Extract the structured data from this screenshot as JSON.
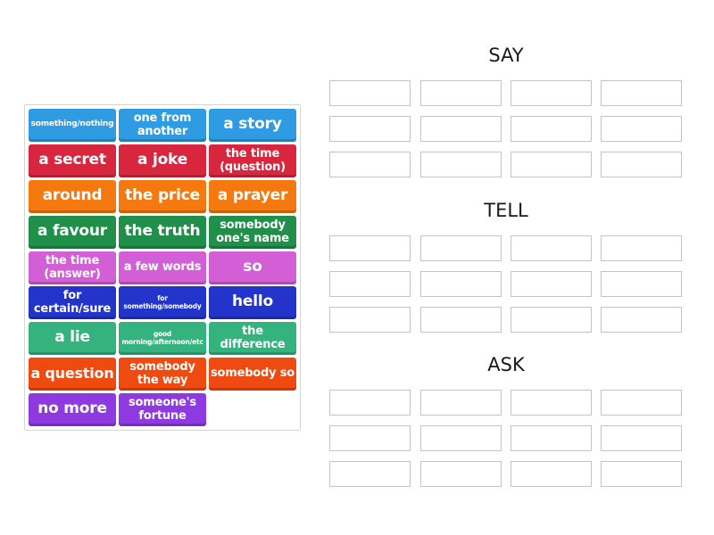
{
  "word_bank": {
    "tiles": [
      {
        "label": "something/nothing",
        "color": "#2e9be3"
      },
      {
        "label": "one from another",
        "color": "#2e9be3"
      },
      {
        "label": "a story",
        "color": "#2e9be3"
      },
      {
        "label": "a secret",
        "color": "#d7263d"
      },
      {
        "label": "a joke",
        "color": "#d7263d"
      },
      {
        "label": "the time (question)",
        "color": "#d7263d"
      },
      {
        "label": "around",
        "color": "#f5790f"
      },
      {
        "label": "the price",
        "color": "#f5790f"
      },
      {
        "label": "a prayer",
        "color": "#f5790f"
      },
      {
        "label": "a favour",
        "color": "#1f8f4a"
      },
      {
        "label": "the truth",
        "color": "#1f8f4a"
      },
      {
        "label": "somebody one's name",
        "color": "#1f8f4a"
      },
      {
        "label": "the time (answer)",
        "color": "#d35fd6"
      },
      {
        "label": "a few words",
        "color": "#d35fd6"
      },
      {
        "label": "so",
        "color": "#d35fd6"
      },
      {
        "label": "for certain/sure",
        "color": "#2234c9"
      },
      {
        "label": "for something/somebody",
        "color": "#2234c9"
      },
      {
        "label": "hello",
        "color": "#2234c9"
      },
      {
        "label": "a lie",
        "color": "#35b37e"
      },
      {
        "label": "good morning/afternoon/etc",
        "color": "#35b37e"
      },
      {
        "label": "the difference",
        "color": "#35b37e"
      },
      {
        "label": "a question",
        "color": "#ef4a10"
      },
      {
        "label": "somebody the way",
        "color": "#ef4a10"
      },
      {
        "label": "somebody so",
        "color": "#ef4a10"
      },
      {
        "label": "no more",
        "color": "#8e3ae0"
      },
      {
        "label": "someone's fortune",
        "color": "#8e3ae0"
      }
    ]
  },
  "groups": [
    {
      "title": "SAY",
      "slots": 12,
      "filled": 0
    },
    {
      "title": "TELL",
      "slots": 12,
      "filled": 0
    },
    {
      "title": "ASK",
      "slots": 12,
      "filled": 0
    }
  ]
}
